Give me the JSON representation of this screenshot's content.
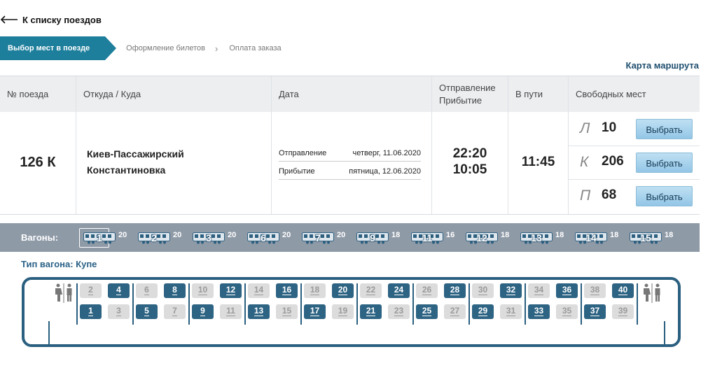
{
  "back_link": {
    "label": "К списку поездов"
  },
  "steps": [
    {
      "label": "Выбор мест в поезде"
    },
    {
      "label": "Оформление билетов"
    },
    {
      "label": "Оплата заказа"
    }
  ],
  "step_separator": "›",
  "route_map_link": "Карта маршрута",
  "table": {
    "headers": {
      "train_no": "№ поезда",
      "route": "Откуда / Куда",
      "date": "Дата",
      "depart_arrive": [
        "Отправление",
        "Прибытие"
      ],
      "travel_time": "В пути",
      "free_seats": "Свободных мест"
    },
    "train_no": "126 К",
    "from": "Киев-Пассажирский",
    "to": "Константиновка",
    "departure_label": "Отправление",
    "departure_date": "четверг, 11.06.2020",
    "arrival_label": "Прибытие",
    "arrival_date": "пятница, 12.06.2020",
    "departure_time": "22:20",
    "arrival_time": "10:05",
    "travel_time": "11:45",
    "classes": [
      {
        "code": "Л",
        "count": "10",
        "button": "Выбрать"
      },
      {
        "code": "К",
        "count": "206",
        "button": "Выбрать"
      },
      {
        "code": "П",
        "count": "68",
        "button": "Выбрать"
      }
    ]
  },
  "wagons_label": "Вагоны:",
  "wagons": [
    {
      "num": "1",
      "free": "20",
      "selected": true
    },
    {
      "num": "2",
      "free": "20"
    },
    {
      "num": "3",
      "free": "20"
    },
    {
      "num": "6",
      "free": "20"
    },
    {
      "num": "7",
      "free": "20"
    },
    {
      "num": "9",
      "free": "18"
    },
    {
      "num": "11",
      "free": "16"
    },
    {
      "num": "12",
      "free": "18"
    },
    {
      "num": "13",
      "free": "18"
    },
    {
      "num": "14",
      "free": "18"
    },
    {
      "num": "15",
      "free": "18"
    }
  ],
  "wagon_type": "Тип вагона: Купе",
  "compartments": [
    {
      "top": [
        {
          "n": "2",
          "free": false
        },
        {
          "n": "4",
          "free": true
        }
      ],
      "bottom": [
        {
          "n": "1",
          "free": true
        },
        {
          "n": "3",
          "free": false
        }
      ]
    },
    {
      "top": [
        {
          "n": "6",
          "free": false
        },
        {
          "n": "8",
          "free": true
        }
      ],
      "bottom": [
        {
          "n": "5",
          "free": true
        },
        {
          "n": "7",
          "free": false
        }
      ]
    },
    {
      "top": [
        {
          "n": "10",
          "free": false
        },
        {
          "n": "12",
          "free": true
        }
      ],
      "bottom": [
        {
          "n": "9",
          "free": true
        },
        {
          "n": "11",
          "free": false
        }
      ]
    },
    {
      "top": [
        {
          "n": "14",
          "free": false
        },
        {
          "n": "16",
          "free": true
        }
      ],
      "bottom": [
        {
          "n": "13",
          "free": true
        },
        {
          "n": "15",
          "free": false
        }
      ]
    },
    {
      "top": [
        {
          "n": "18",
          "free": false
        },
        {
          "n": "20",
          "free": true
        }
      ],
      "bottom": [
        {
          "n": "17",
          "free": true
        },
        {
          "n": "19",
          "free": false
        }
      ]
    },
    {
      "top": [
        {
          "n": "22",
          "free": false
        },
        {
          "n": "24",
          "free": true
        }
      ],
      "bottom": [
        {
          "n": "21",
          "free": true
        },
        {
          "n": "23",
          "free": false
        }
      ]
    },
    {
      "top": [
        {
          "n": "26",
          "free": false
        },
        {
          "n": "28",
          "free": true
        }
      ],
      "bottom": [
        {
          "n": "25",
          "free": true
        },
        {
          "n": "27",
          "free": false
        }
      ]
    },
    {
      "top": [
        {
          "n": "30",
          "free": false
        },
        {
          "n": "32",
          "free": true
        }
      ],
      "bottom": [
        {
          "n": "29",
          "free": true
        },
        {
          "n": "31",
          "free": false
        }
      ]
    },
    {
      "top": [
        {
          "n": "34",
          "free": false
        },
        {
          "n": "36",
          "free": true
        }
      ],
      "bottom": [
        {
          "n": "33",
          "free": true
        },
        {
          "n": "35",
          "free": false
        }
      ]
    },
    {
      "top": [
        {
          "n": "38",
          "free": false
        },
        {
          "n": "40",
          "free": true
        }
      ],
      "bottom": [
        {
          "n": "37",
          "free": true
        },
        {
          "n": "39",
          "free": false
        }
      ]
    }
  ],
  "icons": {
    "back": "arrow-left-icon",
    "wagon": "train-car-icon",
    "wc": "restroom-icon"
  },
  "colors": {
    "accent": "#1e7f9c",
    "seat_free": "#2d6383",
    "seat_busy": "#dcdcdc",
    "wagon_bar": "#8f9aa7",
    "car_outline": "#2a5f7f"
  }
}
